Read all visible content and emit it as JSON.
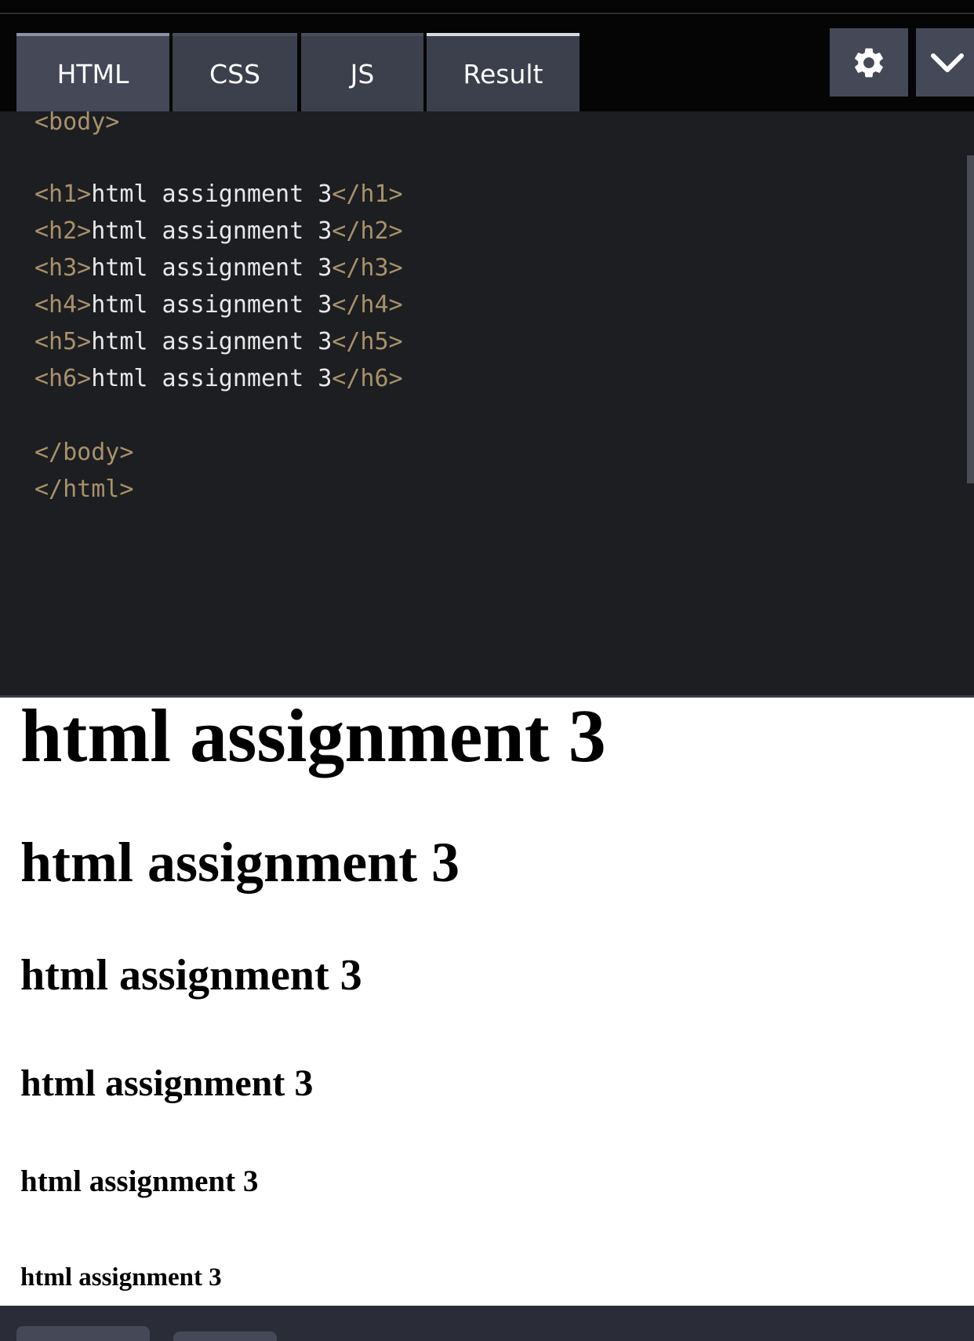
{
  "tabs": [
    {
      "label": "HTML"
    },
    {
      "label": "CSS"
    },
    {
      "label": "JS"
    },
    {
      "label": "Result"
    }
  ],
  "toolbar": {
    "settings_icon": "gear-icon",
    "collapse_icon": "chevron-down-icon"
  },
  "editor": {
    "lines": [
      {
        "open": "<body>",
        "text": "",
        "close": ""
      },
      {
        "open": "",
        "text": "",
        "close": ""
      },
      {
        "open": "<h1>",
        "text": "html assignment 3",
        "close": "</h1>"
      },
      {
        "open": "<h2>",
        "text": "html assignment 3",
        "close": "</h2>"
      },
      {
        "open": "<h3>",
        "text": "html assignment 3",
        "close": "</h3>"
      },
      {
        "open": "<h4>",
        "text": "html assignment 3",
        "close": "</h4>"
      },
      {
        "open": "<h5>",
        "text": "html assignment 3",
        "close": "</h5>"
      },
      {
        "open": "<h6>",
        "text": "html assignment 3",
        "close": "</h6>"
      },
      {
        "open": "",
        "text": "",
        "close": ""
      },
      {
        "open": "</body>",
        "text": "",
        "close": ""
      },
      {
        "open": "</html>",
        "text": "",
        "close": ""
      }
    ]
  },
  "result": {
    "h1": "html assignment 3",
    "h2": "html assignment 3",
    "h3": "html assignment 3",
    "h4": "html assignment 3",
    "h5": "html assignment 3",
    "h6": "html assignment 3"
  },
  "colors": {
    "tag": "#a8926a",
    "code_text": "#e8e8e8",
    "editor_bg": "#1d1e22",
    "tab_bg": "#3c3f4c"
  }
}
